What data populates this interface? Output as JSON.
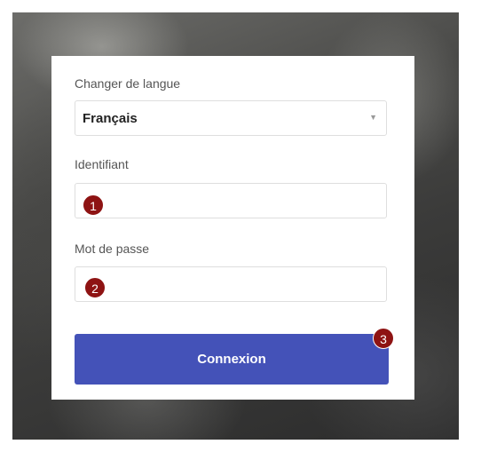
{
  "login": {
    "language_label": "Changer de langue",
    "language_value": "Français",
    "username_label": "Identifiant",
    "password_label": "Mot de passe",
    "submit_label": "Connexion"
  },
  "annotations": {
    "badge1": "1",
    "badge2": "2",
    "badge3": "3"
  },
  "colors": {
    "button": "#4452b8",
    "badge": "#8e1313"
  },
  "icons": {
    "dropdown": "chevron-down-icon"
  }
}
